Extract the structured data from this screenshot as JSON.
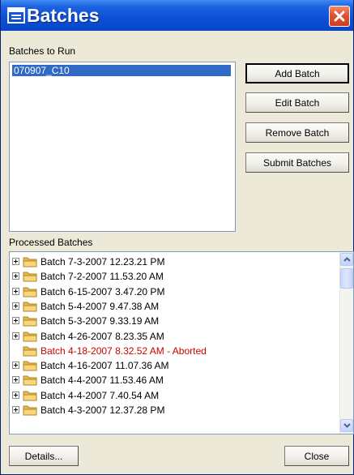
{
  "window": {
    "title": "Batches"
  },
  "batches_to_run": {
    "label": "Batches to Run",
    "items": [
      "070907_C10"
    ]
  },
  "buttons": {
    "add": "Add Batch",
    "edit": "Edit Batch",
    "remove": "Remove Batch",
    "submit": "Submit Batches",
    "details": "Details...",
    "close": "Close"
  },
  "processed_batches": {
    "label": "Processed Batches",
    "items": [
      {
        "text": "Batch 7-3-2007 12.23.21 PM",
        "expandable": true,
        "aborted": false
      },
      {
        "text": "Batch 7-2-2007 11.53.20 AM",
        "expandable": true,
        "aborted": false
      },
      {
        "text": "Batch 6-15-2007 3.47.20 PM",
        "expandable": true,
        "aborted": false
      },
      {
        "text": "Batch 5-4-2007 9.47.38 AM",
        "expandable": true,
        "aborted": false
      },
      {
        "text": "Batch 5-3-2007 9.33.19 AM",
        "expandable": true,
        "aborted": false
      },
      {
        "text": "Batch 4-26-2007 8.23.35 AM",
        "expandable": true,
        "aborted": false
      },
      {
        "text": "Batch 4-18-2007 8.32.52 AM - Aborted",
        "expandable": false,
        "aborted": true
      },
      {
        "text": "Batch 4-16-2007 11.07.36 AM",
        "expandable": true,
        "aborted": false
      },
      {
        "text": "Batch 4-4-2007 11.53.46 AM",
        "expandable": true,
        "aborted": false
      },
      {
        "text": "Batch 4-4-2007 7.40.54 AM",
        "expandable": true,
        "aborted": false
      },
      {
        "text": "Batch 4-3-2007 12.37.28 PM",
        "expandable": true,
        "aborted": false
      }
    ]
  },
  "colors": {
    "aborted_text": "#cc0000",
    "selection": "#316ac5",
    "title_bar": "#0b4fd6"
  },
  "icons": {
    "title": "window-list-icon",
    "close": "close-x-icon",
    "folder": "folder-icon",
    "expand": "plus-expander-icon",
    "scroll_up": "chevron-up-icon",
    "scroll_down": "chevron-down-icon"
  }
}
